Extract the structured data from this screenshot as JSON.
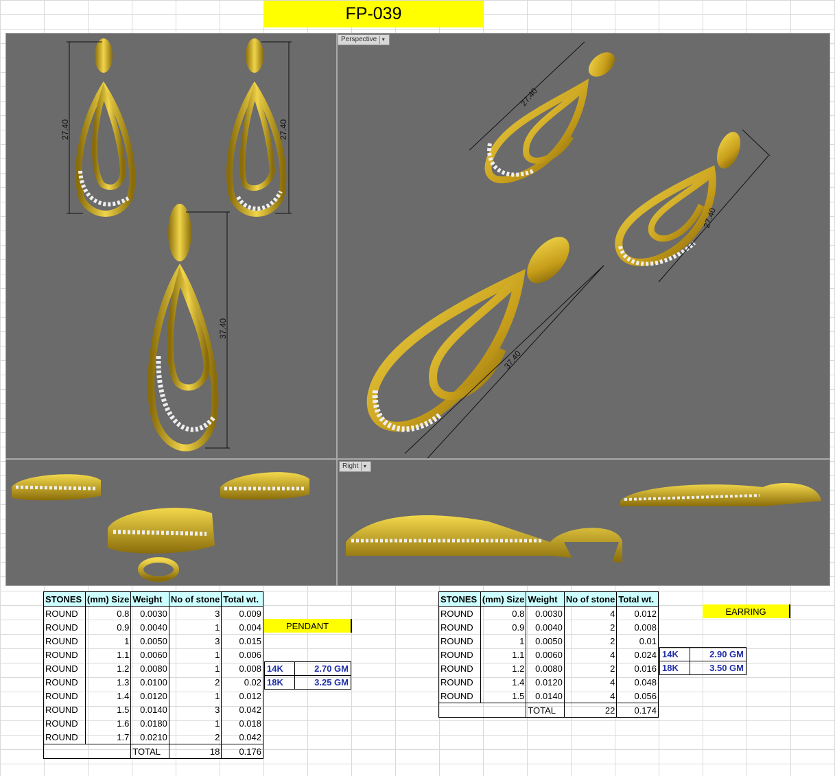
{
  "title": "FP-039",
  "viewports": {
    "perspective_label": "Perspective",
    "right_label": "Right",
    "dims": {
      "earring_height": "27.40",
      "pendant_height": "37.40"
    }
  },
  "pendant_table": {
    "headers": [
      "STONES",
      "(mm) Size",
      "Weight",
      "No of stone",
      "Total wt."
    ],
    "rows": [
      [
        "ROUND",
        "0.8",
        "0.0030",
        "3",
        "0.009"
      ],
      [
        "ROUND",
        "0.9",
        "0.0040",
        "1",
        "0.004"
      ],
      [
        "ROUND",
        "1",
        "0.0050",
        "3",
        "0.015"
      ],
      [
        "ROUND",
        "1.1",
        "0.0060",
        "1",
        "0.006"
      ],
      [
        "ROUND",
        "1.2",
        "0.0080",
        "1",
        "0.008"
      ],
      [
        "ROUND",
        "1.3",
        "0.0100",
        "2",
        "0.02"
      ],
      [
        "ROUND",
        "1.4",
        "0.0120",
        "1",
        "0.012"
      ],
      [
        "ROUND",
        "1.5",
        "0.0140",
        "3",
        "0.042"
      ],
      [
        "ROUND",
        "1.6",
        "0.0180",
        "1",
        "0.018"
      ],
      [
        "ROUND",
        "1.7",
        "0.0210",
        "2",
        "0.042"
      ]
    ],
    "total_label": "TOTAL",
    "total_count": "18",
    "total_wt": "0.176",
    "tag": "PENDANT",
    "metal": [
      [
        "14K",
        "2.70 GM"
      ],
      [
        "18K",
        "3.25 GM"
      ]
    ]
  },
  "earring_table": {
    "headers": [
      "STONES",
      "(mm) Size",
      "Weight",
      "No of stone",
      "Total wt."
    ],
    "rows": [
      [
        "ROUND",
        "0.8",
        "0.0030",
        "4",
        "0.012"
      ],
      [
        "ROUND",
        "0.9",
        "0.0040",
        "2",
        "0.008"
      ],
      [
        "ROUND",
        "1",
        "0.0050",
        "2",
        "0.01"
      ],
      [
        "ROUND",
        "1.1",
        "0.0060",
        "4",
        "0.024"
      ],
      [
        "ROUND",
        "1.2",
        "0.0080",
        "2",
        "0.016"
      ],
      [
        "ROUND",
        "1.4",
        "0.0120",
        "4",
        "0.048"
      ],
      [
        "ROUND",
        "1.5",
        "0.0140",
        "4",
        "0.056"
      ]
    ],
    "total_label": "TOTAL",
    "total_count": "22",
    "total_wt": "0.174",
    "tag": "EARRING",
    "metal": [
      [
        "14K",
        "2.90 GM"
      ],
      [
        "18K",
        "3.50 GM"
      ]
    ]
  },
  "colors": {
    "gold": "#d4b22a",
    "gold_dark": "#8a6d0a",
    "viewport": "#6b6b6b",
    "highlight": "#ffff00",
    "header": "#ccffff"
  }
}
